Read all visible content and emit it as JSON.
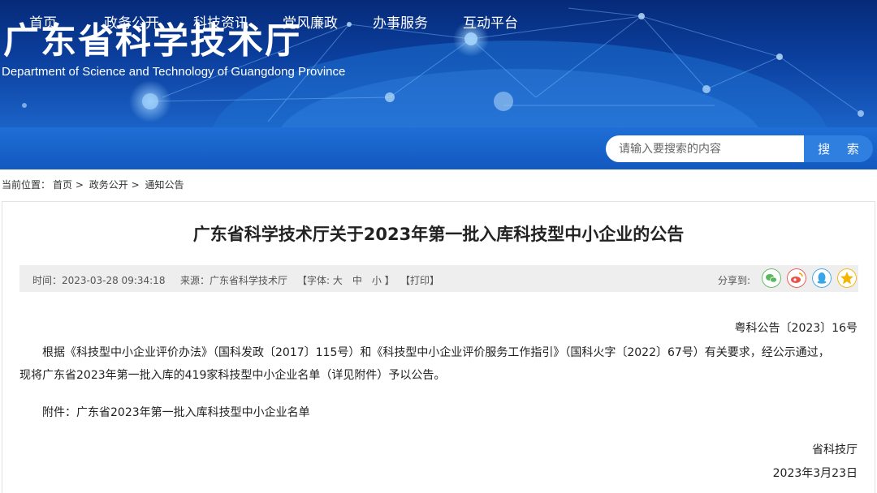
{
  "header": {
    "title": "广东省科学技术厅",
    "subtitle": "Department of Science and Technology of Guangdong Province"
  },
  "nav": {
    "items": [
      "首页",
      "政务公开",
      "科技资讯",
      "党风廉政",
      "办事服务",
      "互动平台"
    ]
  },
  "search": {
    "placeholder": "请输入要搜索的内容",
    "button_label": "搜 索"
  },
  "breadcrumb": {
    "prefix": "当前位置：",
    "items": [
      "首页",
      "政务公开",
      "通知公告"
    ],
    "separator": ">"
  },
  "article": {
    "title": "广东省科学技术厅关于2023年第一批入库科技型中小企业的公告",
    "meta": {
      "time": "时间：2023-03-28 09:34:18",
      "source": "来源：广东省科学技术厅",
      "font_size_label": "【字体: 大　中　小 】",
      "print_label": "【打印】",
      "share_label": "分享到:"
    },
    "doc_number": "粤科公告〔2023〕16号",
    "paragraph_line1": "根据《科技型中小企业评价办法》（国科发政〔2017〕115号）和《科技型中小企业评价服务工作指引》（国科火字〔2022〕67号）有关要求，经公示通过，",
    "paragraph_line2": "现将广东省2023年第一批入库的419家科技型中小企业名单（详见附件）予以公告。",
    "attachment": "附件：广东省2023年第一批入库科技型中小企业名单",
    "signature": "省科技厅",
    "date": "2023年3月23日"
  },
  "colors": {
    "nav_bg": "#1a64cc",
    "search_button": "#2f7fe0",
    "share_wechat": "#5cb85c",
    "share_weibo": "#e8544a",
    "share_qq": "#3aa6e8",
    "share_qzone": "#f4b400"
  }
}
